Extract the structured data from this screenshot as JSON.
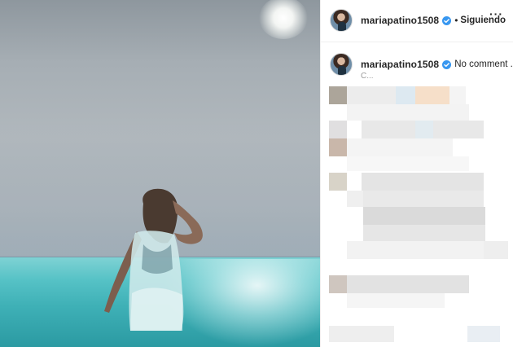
{
  "post": {
    "username": "mariapatino1508",
    "header": {
      "dot": "•",
      "follow_label": "Siguiendo",
      "more_label": "···"
    },
    "caption": {
      "text": "No comment ..",
      "partial_line": "C..."
    }
  },
  "colors": {
    "verified_blue": "#3897f0",
    "text": "#262626",
    "divider": "#efefef"
  },
  "icons": {
    "verified": "verified-badge-icon",
    "more": "more-options-icon"
  }
}
